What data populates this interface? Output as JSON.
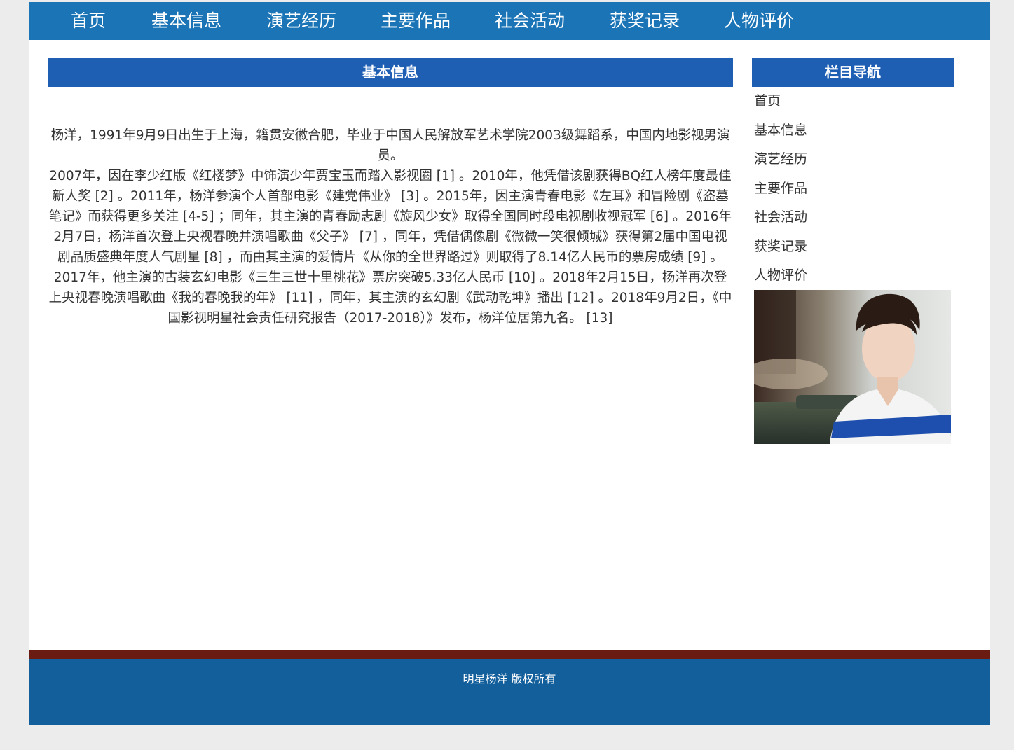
{
  "nav": {
    "items": [
      "首页",
      "基本信息",
      "演艺经历",
      "主要作品",
      "社会活动",
      "获奖记录",
      "人物评价"
    ]
  },
  "main": {
    "header": "基本信息",
    "paragraphs": [
      "杨洋，1991年9月9日出生于上海，籍贯安徽合肥，毕业于中国人民解放军艺术学院2003级舞蹈系，中国内地影视男演员。",
      "2007年，因在李少红版《红楼梦》中饰演少年贾宝玉而踏入影视圈 [1] 。2010年，他凭借该剧获得BQ红人榜年度最佳新人奖 [2] 。2011年，杨洋参演个人首部电影《建党伟业》 [3] 。2015年，因主演青春电影《左耳》和冒险剧《盗墓笔记》而获得更多关注 [4-5] ；同年，其主演的青春励志剧《旋风少女》取得全国同时段电视剧收视冠军 [6] 。2016年2月7日，杨洋首次登上央视春晚并演唱歌曲《父子》 [7] ，同年，凭借偶像剧《微微一笑很倾城》获得第2届中国电视剧品质盛典年度人气剧星 [8] ，而由其主演的爱情片《从你的全世界路过》则取得了8.14亿人民币的票房成绩 [9] 。2017年，他主演的古装玄幻电影《三生三世十里桃花》票房突破5.33亿人民币 [10] 。2018年2月15日，杨洋再次登上央视春晚演唱歌曲《我的春晚我的年》 [11] ，同年，其主演的玄幻剧《武动乾坤》播出 [12] 。2018年9月2日，《中国影视明星社会责任研究报告（2017-2018）》发布，杨洋位居第九名。 [13]"
    ]
  },
  "sidebar": {
    "header": "栏目导航",
    "items": [
      "首页",
      "基本信息",
      "演艺经历",
      "主要作品",
      "社会活动",
      "获奖记录",
      "人物评价"
    ]
  },
  "footer": {
    "text": "明星杨洋 版权所有"
  },
  "colors": {
    "nav_bg": "#1a74b6",
    "header_bg": "#1e5fb4",
    "footer_line": "#6b1c12",
    "footer_bg": "#135f9c",
    "page_bg": "#ececec"
  }
}
